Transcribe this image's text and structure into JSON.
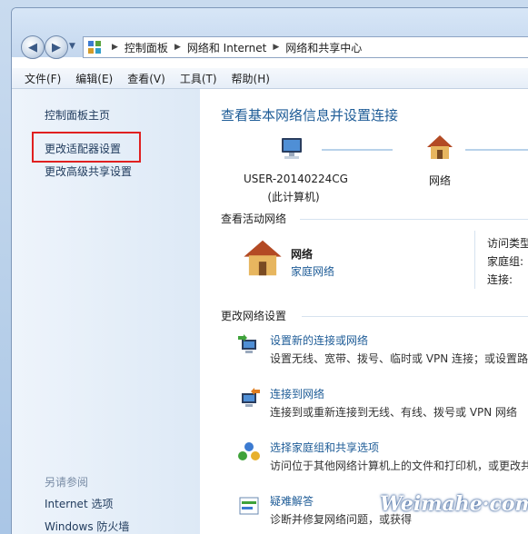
{
  "address_bar": {
    "segments": [
      "控制面板",
      "网络和 Internet",
      "网络和共享中心"
    ]
  },
  "menu": [
    "文件(F)",
    "编辑(E)",
    "查看(V)",
    "工具(T)",
    "帮助(H)"
  ],
  "left_pane": {
    "links": [
      "控制面板主页",
      "更改适配器设置",
      "更改高级共享设置"
    ],
    "see_also_title": "另请参阅",
    "see_also": [
      "Internet 选项",
      "Windows 防火墙"
    ]
  },
  "main": {
    "title": "查看基本网络信息并设置连接",
    "network_map": {
      "computer_name": "USER-20140224CG",
      "computer_sub": "(此计算机)",
      "network_label": "网络"
    },
    "active_networks_heading": "查看活动网络",
    "active_network": {
      "name": "网络",
      "type": "家庭网络",
      "access_type_label": "访问类型",
      "homegroup_label": "家庭组:",
      "connection_label": "连接:"
    },
    "change_settings_heading": "更改网络设置",
    "tasks": [
      {
        "link": "设置新的连接或网络",
        "desc": "设置无线、宽带、拨号、临时或 VPN 连接；或设置路",
        "icon": "network-setup-icon"
      },
      {
        "link": "连接到网络",
        "desc": "连接到或重新连接到无线、有线、拨号或 VPN 网络",
        "icon": "connect-network-icon"
      },
      {
        "link": "选择家庭组和共享选项",
        "desc": "访问位于其他网络计算机上的文件和打印机，或更改共",
        "icon": "homegroup-icon"
      },
      {
        "link": "疑难解答",
        "desc": "诊断并修复网络问题，或获得",
        "icon": "troubleshoot-icon"
      }
    ]
  },
  "watermark": "Weimahe·com"
}
